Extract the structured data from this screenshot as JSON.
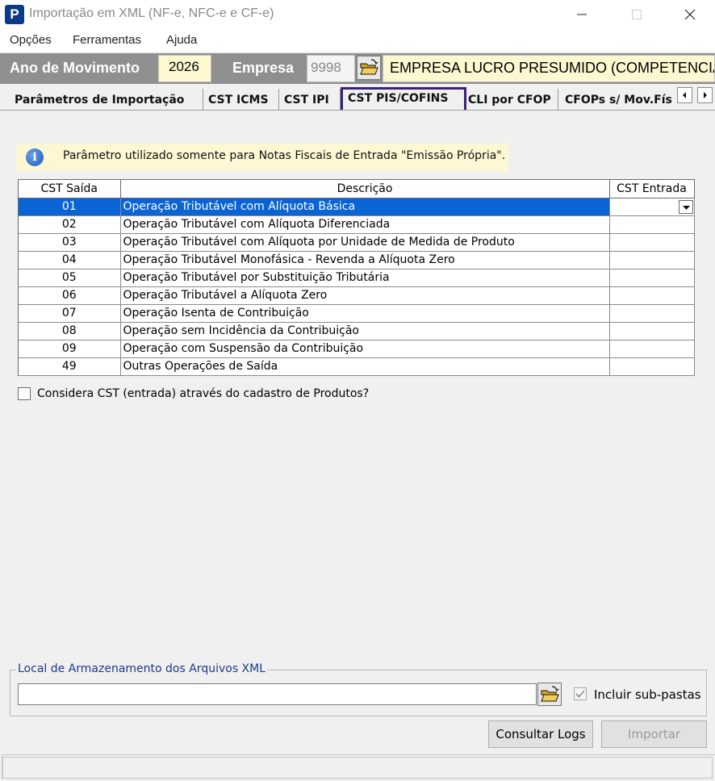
{
  "window": {
    "title": "Importação em XML (NF-e, NFC-e e CF-e)"
  },
  "menu": {
    "items": [
      "Opções",
      "Ferramentas",
      "Ajuda"
    ]
  },
  "header": {
    "ano_label": "Ano de Movimento",
    "ano_value": "2026",
    "empresa_label": "Empresa",
    "empresa_code": "9998",
    "empresa_name": "EMPRESA LUCRO PRESUMIDO (COMPETENCIA)"
  },
  "tabs": [
    {
      "label": "Parâmetros de Importação",
      "active": false
    },
    {
      "label": "CST ICMS",
      "active": false
    },
    {
      "label": "CST IPI",
      "active": false
    },
    {
      "label": "CST PIS/COFINS",
      "active": true
    },
    {
      "label": "CLI por CFOP",
      "active": false
    },
    {
      "label": "CFOPs s/ Mov.Fís",
      "active": false
    }
  ],
  "info": {
    "text": "Parâmetro utilizado somente para Notas Fiscais de Entrada \"Emissão Própria\"."
  },
  "grid": {
    "columns": [
      "CST Saída",
      "Descrição",
      "CST Entrada"
    ],
    "rows": [
      {
        "cst_saida": "01",
        "descricao": "Operação Tributável com Alíquota Básica",
        "cst_entrada": "",
        "selected": true
      },
      {
        "cst_saida": "02",
        "descricao": "Operação Tributável com Alíquota Diferenciada",
        "cst_entrada": ""
      },
      {
        "cst_saida": "03",
        "descricao": "Operação Tributável com Alíquota por Unidade de Medida de Produto",
        "cst_entrada": ""
      },
      {
        "cst_saida": "04",
        "descricao": "Operação Tributável Monofásica - Revenda a Alíquota Zero",
        "cst_entrada": ""
      },
      {
        "cst_saida": "05",
        "descricao": "Operação Tributável por Substituição Tributária",
        "cst_entrada": ""
      },
      {
        "cst_saida": "06",
        "descricao": "Operação Tributável a Alíquota Zero",
        "cst_entrada": ""
      },
      {
        "cst_saida": "07",
        "descricao": "Operação Isenta de Contribuição",
        "cst_entrada": ""
      },
      {
        "cst_saida": "08",
        "descricao": "Operação sem Incidência da Contribuição",
        "cst_entrada": ""
      },
      {
        "cst_saida": "09",
        "descricao": "Operação com Suspensão da Contribuição",
        "cst_entrada": ""
      },
      {
        "cst_saida": "49",
        "descricao": "Outras Operações de Saída",
        "cst_entrada": ""
      }
    ]
  },
  "options": {
    "considera_label": "Considera CST (entrada) através do cadastro de Produtos?",
    "considera_checked": false
  },
  "storage": {
    "legend": "Local de Armazenamento dos Arquivos XML",
    "path_value": "",
    "subfolders_label": "Incluir sub-pastas",
    "subfolders_checked": true
  },
  "buttons": {
    "consultar_logs": "Consultar Logs",
    "importar": "Importar"
  }
}
